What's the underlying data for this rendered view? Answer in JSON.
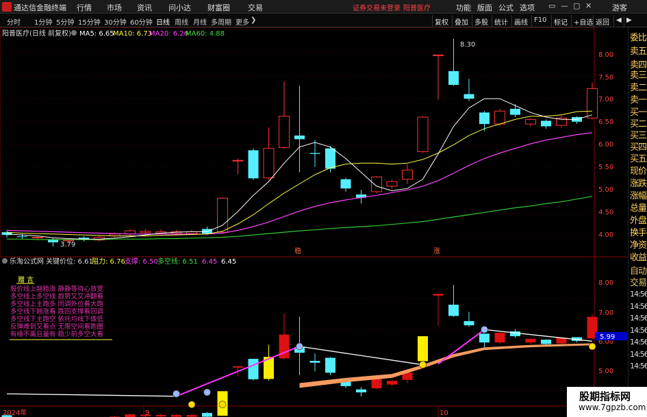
{
  "titlebar": {
    "title": "通达信金融终端",
    "menus": [
      "行情",
      "市场",
      "资讯",
      "问小达",
      "财富圈",
      "交易"
    ],
    "status_left": "证券交易未登录",
    "status_right": "阳普医疗",
    "right_menus": [
      "功能",
      "版面",
      "公式",
      "选项"
    ],
    "guest": "游客"
  },
  "toolbar": {
    "timeframes": [
      "分时",
      "1分钟",
      "5分钟",
      "15分钟",
      "30分钟",
      "60分钟",
      "日线",
      "周线",
      "月线",
      "多周期",
      "更多"
    ],
    "active_timeframe": "日线",
    "more_arrow": "❯",
    "right_buttons": [
      "复权",
      "叠加",
      "多股",
      "统计",
      "画线",
      "F10",
      "标记",
      "+自选",
      "返回"
    ]
  },
  "main_panel": {
    "stock_label": "阳普医疗(日线 前复权)",
    "ma_labels": [
      {
        "text": "MA5: 6.65",
        "color": "#ffffff"
      },
      {
        "text": "MA10: 6.73",
        "color": "#ffff44"
      },
      {
        "text": "MA20: 6.26",
        "color": "#ff44ff"
      },
      {
        "text": "MA60: 4.88",
        "color": "#44dd44"
      }
    ],
    "high_marker": "8.30",
    "low_marker": "3.79",
    "sig1": "稳",
    "sig2": "涨",
    "price_ticks": [
      "8.00",
      "7.50",
      "7.00",
      "6.50",
      "6.00",
      "5.50",
      "5.00",
      "4.50",
      "4.00"
    ]
  },
  "sub_panel": {
    "indicator_name": "乐淘公式网",
    "labels": [
      {
        "text": "关键价位: 6.61",
        "color": "#dddddd"
      },
      {
        "text": "阻力: 6.76",
        "color": "#ffff44"
      },
      {
        "text": "支撑: 6.50",
        "color": "#ff44ff"
      },
      {
        "text": "多空线: 6.51",
        "color": "#44dd44"
      },
      {
        "text": "6.45",
        "color": "#ff44ff"
      },
      {
        "text": "6.45",
        "color": "#ffffff"
      }
    ],
    "note_title": "赠 言",
    "note_lines": [
      "股价线上翘稳涨  静静等待心放宽",
      "多空线上多空线  趋势又又冲翻看",
      "多空线上主跑多  同调外位看大跑",
      "多空线下翘涨看  跌回支撑看回调",
      "多空线下主跑空  依托均线下做低",
      "反弹难到又看点  无限空间看跑圈",
      "有缘不离且量有  稳少前多空大看"
    ],
    "price_ticks": [
      "8.00",
      "7.00",
      "6.00",
      "5.00"
    ],
    "current_price": "5.99"
  },
  "x_axis": {
    "labels": [
      "2024年",
      "9",
      "10"
    ]
  },
  "side_panel": {
    "items_top": [
      "委比",
      "卖五",
      "卖四",
      "卖三",
      "卖二",
      "卖一",
      "买一",
      "买二",
      "买三",
      "买四",
      "买五",
      "现价",
      "涨跌",
      "涨幅",
      "总量",
      "外盘",
      "换手",
      "净资",
      "收益"
    ],
    "items_bottom": [
      "自动",
      "交易"
    ],
    "times": [
      "14:56",
      "14:56",
      "14:56",
      "14:56",
      "14:56",
      "14:56",
      "14:56"
    ]
  },
  "watermark": {
    "line1": "股期指标网",
    "line2": "www.7gpzb.com"
  },
  "chart_data": {
    "type": "candlestick",
    "title": "阳普医疗(日线 前复权)",
    "ylim": [
      3.7,
      8.4
    ],
    "colors": {
      "up": "#ff3333",
      "down": "#55eeff",
      "ma5": "#ffffff",
      "ma10": "#ffff44",
      "ma20": "#ff44ff",
      "ma60": "#33cc33"
    },
    "candles": [
      {
        "o": 4.1,
        "c": 4.04,
        "h": 4.14,
        "l": 3.98
      },
      {
        "o": 4.01,
        "c": 4.0,
        "h": 4.06,
        "l": 3.96
      },
      {
        "o": 3.98,
        "c": 3.99,
        "h": 4.02,
        "l": 3.94
      },
      {
        "o": 3.94,
        "c": 3.88,
        "h": 3.97,
        "l": 3.79
      },
      {
        "o": 3.91,
        "c": 3.93,
        "h": 3.96,
        "l": 3.86
      },
      {
        "o": 3.98,
        "c": 3.94,
        "h": 4.01,
        "l": 3.9
      },
      {
        "o": 3.93,
        "c": 3.99,
        "h": 4.03,
        "l": 3.9
      },
      {
        "o": 4.02,
        "c": 4.06,
        "h": 4.09,
        "l": 3.99
      },
      {
        "o": 4.06,
        "c": 4.13,
        "h": 4.16,
        "l": 4.03
      },
      {
        "o": 4.09,
        "c": 4.12,
        "h": 4.17,
        "l": 4.06
      },
      {
        "o": 4.08,
        "c": 4.11,
        "h": 4.16,
        "l": 4.05
      },
      {
        "o": 4.07,
        "c": 4.11,
        "h": 4.15,
        "l": 4.04
      },
      {
        "o": 4.07,
        "c": 4.11,
        "h": 4.15,
        "l": 4.04
      },
      {
        "o": 4.17,
        "c": 4.07,
        "h": 4.22,
        "l": 4.04
      },
      {
        "o": 4.1,
        "c": 4.84,
        "h": 4.86,
        "l": 4.1
      },
      {
        "o": 5.65,
        "c": 5.66,
        "h": 5.7,
        "l": 5.36
      },
      {
        "o": 5.88,
        "c": 5.27,
        "h": 5.92,
        "l": 5.23
      },
      {
        "o": 5.28,
        "c": 5.92,
        "h": 6.38,
        "l": 5.23
      },
      {
        "o": 5.94,
        "c": 6.62,
        "h": 7.38,
        "l": 5.91
      },
      {
        "o": 6.2,
        "c": 6.12,
        "h": 7.28,
        "l": 5.4
      },
      {
        "o": 5.82,
        "c": 5.8,
        "h": 6.1,
        "l": 5.52
      },
      {
        "o": 5.92,
        "c": 5.48,
        "h": 5.98,
        "l": 5.4
      },
      {
        "o": 5.25,
        "c": 5.05,
        "h": 5.28,
        "l": 4.98
      },
      {
        "o": 4.92,
        "c": 4.85,
        "h": 5.02,
        "l": 4.72
      },
      {
        "o": 4.98,
        "c": 5.3,
        "h": 5.32,
        "l": 4.95
      },
      {
        "o": 5.1,
        "c": 5.2,
        "h": 5.24,
        "l": 5.05
      },
      {
        "o": 5.25,
        "c": 5.45,
        "h": 5.58,
        "l": 5.15
      },
      {
        "o": 5.85,
        "c": 6.6,
        "h": 6.62,
        "l": 5.82
      },
      {
        "o": 7.95,
        "c": 7.95,
        "h": 7.96,
        "l": 6.98
      },
      {
        "o": 7.6,
        "c": 7.3,
        "h": 8.3,
        "l": 7.28
      },
      {
        "o": 7.1,
        "c": 7.0,
        "h": 7.43,
        "l": 6.95
      },
      {
        "o": 6.7,
        "c": 6.45,
        "h": 6.73,
        "l": 6.3
      },
      {
        "o": 6.45,
        "c": 6.73,
        "h": 6.78,
        "l": 6.4
      },
      {
        "o": 6.78,
        "c": 6.65,
        "h": 6.88,
        "l": 6.6
      },
      {
        "o": 6.45,
        "c": 6.55,
        "h": 6.58,
        "l": 6.4
      },
      {
        "o": 6.52,
        "c": 6.4,
        "h": 6.55,
        "l": 6.35
      },
      {
        "o": 6.42,
        "c": 6.58,
        "h": 6.63,
        "l": 6.37
      },
      {
        "o": 6.6,
        "c": 6.5,
        "h": 6.62,
        "l": 6.45
      },
      {
        "o": 6.58,
        "c": 7.22,
        "h": 7.35,
        "l": 6.55
      }
    ],
    "ma5": [
      4.06,
      4.04,
      4.02,
      3.98,
      3.96,
      3.95,
      3.95,
      3.97,
      4.0,
      4.04,
      4.08,
      4.1,
      4.11,
      4.11,
      4.25,
      4.55,
      4.9,
      5.2,
      5.6,
      5.95,
      6.05,
      5.95,
      5.7,
      5.4,
      5.1,
      5.0,
      5.05,
      5.25,
      5.8,
      6.4,
      6.8,
      7.0,
      7.0,
      6.85,
      6.7,
      6.6,
      6.55,
      6.55,
      6.65
    ],
    "ma10": [
      4.1,
      4.08,
      4.07,
      4.06,
      4.05,
      4.04,
      4.03,
      4.02,
      4.02,
      4.02,
      4.03,
      4.04,
      4.05,
      4.06,
      4.12,
      4.28,
      4.48,
      4.72,
      4.95,
      5.15,
      5.35,
      5.5,
      5.58,
      5.6,
      5.6,
      5.58,
      5.6,
      5.68,
      5.82,
      6.0,
      6.2,
      6.35,
      6.45,
      6.55,
      6.62,
      6.62,
      6.65,
      6.72,
      6.73
    ],
    "ma20": [
      4.14,
      4.13,
      4.12,
      4.11,
      4.1,
      4.09,
      4.08,
      4.07,
      4.06,
      4.06,
      4.06,
      4.06,
      4.06,
      4.06,
      4.08,
      4.14,
      4.22,
      4.32,
      4.44,
      4.56,
      4.66,
      4.74,
      4.8,
      4.85,
      4.9,
      4.96,
      5.02,
      5.1,
      5.22,
      5.38,
      5.55,
      5.7,
      5.82,
      5.92,
      6.02,
      6.1,
      6.16,
      6.22,
      6.26
    ],
    "ma60": [
      3.95,
      3.95,
      3.94,
      3.94,
      3.94,
      3.94,
      3.94,
      3.95,
      3.95,
      3.95,
      3.96,
      3.96,
      3.97,
      3.98,
      3.99,
      4.01,
      4.04,
      4.07,
      4.1,
      4.13,
      4.15,
      4.18,
      4.2,
      4.22,
      4.24,
      4.27,
      4.3,
      4.33,
      4.38,
      4.43,
      4.48,
      4.53,
      4.58,
      4.63,
      4.67,
      4.72,
      4.76,
      4.82,
      4.88
    ],
    "sub_ylim": [
      4.5,
      9.0
    ],
    "sub_yellow_bars": [
      14,
      17,
      27
    ],
    "sub_pink_lines": [
      [
        11,
        4.82,
        19,
        6.45
      ],
      [
        28,
        5.88,
        31,
        7.0
      ]
    ],
    "sub_white_lines": [
      [
        0,
        4.9,
        11,
        4.82
      ],
      [
        19,
        6.45,
        27,
        5.85
      ],
      [
        31,
        7.0,
        38,
        6.62
      ]
    ],
    "sub_orange_band": [
      [
        19,
        5.25
      ],
      [
        22,
        5.42
      ],
      [
        25,
        5.55
      ],
      [
        27,
        5.85
      ],
      [
        29,
        6.2
      ],
      [
        31,
        6.42
      ],
      [
        34,
        6.5
      ],
      [
        38,
        6.55
      ]
    ]
  }
}
